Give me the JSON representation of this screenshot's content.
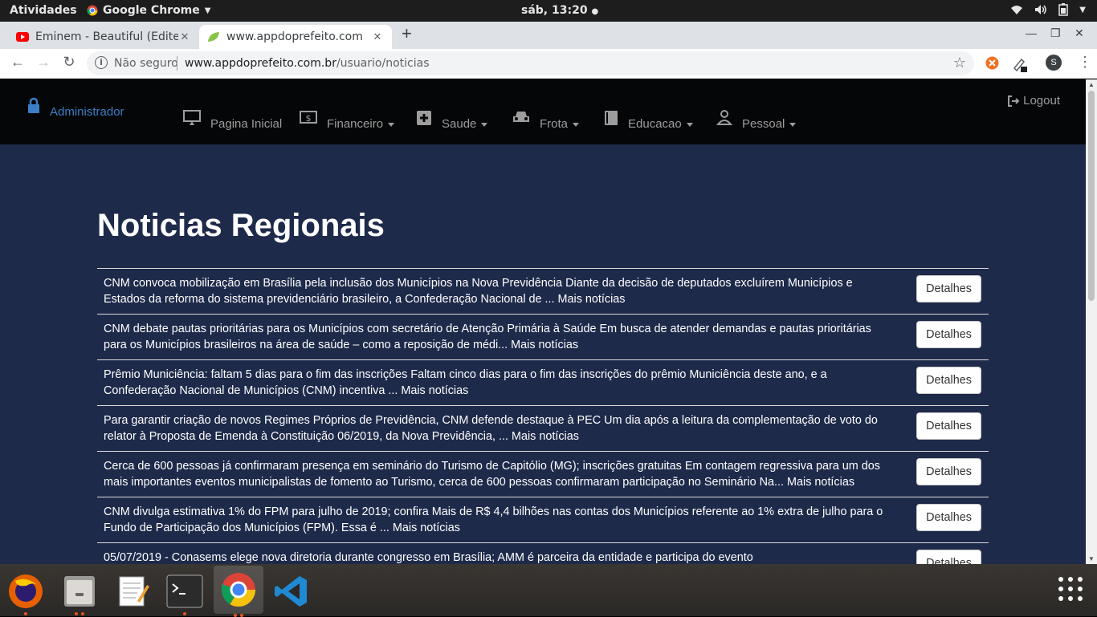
{
  "topbar": {
    "activities": "Atividades",
    "app_name": "Google Chrome",
    "clock": "sáb, 13:20"
  },
  "tabs": [
    {
      "title": "Eminem - Beautiful (Edite",
      "icon": "youtube-icon",
      "active": false
    },
    {
      "title": "www.appdoprefeito.com",
      "icon": "leaf-icon",
      "active": true
    }
  ],
  "omnibox": {
    "security": "Não seguro",
    "host": "www.appdoprefeito.com.br",
    "path": "/usuario/noticias"
  },
  "profile_initial": "S",
  "navbar": {
    "user": "Administrador",
    "logout": "Logout",
    "menu": [
      {
        "label": "Pagina Inicial",
        "icon": "monitor-icon",
        "dropdown": false
      },
      {
        "label": "Financeiro",
        "icon": "money-icon",
        "dropdown": true
      },
      {
        "label": "Saude",
        "icon": "plus-square-icon",
        "dropdown": true
      },
      {
        "label": "Frota",
        "icon": "car-icon",
        "dropdown": true
      },
      {
        "label": "Educacao",
        "icon": "book-icon",
        "dropdown": true
      },
      {
        "label": "Pessoal",
        "icon": "user-icon",
        "dropdown": true
      }
    ]
  },
  "page": {
    "heading": "Noticias Regionais",
    "details_label": "Detalhes",
    "news": [
      "CNM convoca mobilização em Brasília pela inclusão dos Municípios na Nova Previdência Diante da decisão de deputados excluírem Municípios e Estados da reforma do sistema previdenciário brasileiro, a Confederação Nacional de ... Mais notícias",
      "CNM debate pautas prioritárias para os Municípios com secretário de Atenção Primária à Saúde Em busca de atender demandas e pautas prioritárias para os Municípios brasileiros na área de saúde – como a reposição de médi... Mais notícias",
      "Prêmio Municiência: faltam 5 dias para o fim das inscrições Faltam cinco dias para o fim das inscrições do prêmio Municiência deste ano, e a Confederação Nacional de Municípios (CNM) incentiva ... Mais notícias",
      "Para garantir criação de novos Regimes Próprios de Previdência, CNM defende destaque à PEC Um dia após a leitura da complementação de voto do relator à Proposta de Emenda à Constituição 06/2019, da Nova Previdência, ... Mais notícias",
      "Cerca de 600 pessoas já confirmaram presença em seminário do Turismo de Capitólio (MG); inscrições gratuitas Em contagem regressiva para um dos mais importantes eventos municipalistas de fomento ao Turismo, cerca de 600 pessoas confirmaram participação no Seminário Na... Mais notícias",
      "CNM divulga estimativa 1% do FPM para julho de 2019; confira Mais de R$ 4,4 bilhões nas contas dos Municípios referente ao 1% extra de julho para o Fundo de Participação dos Municípios (FPM). Essa é ... Mais notícias",
      "05/07/2019 - Conasems elege nova diretoria durante congresso em Brasília; AMM é parceira da entidade e participa do evento"
    ]
  },
  "dock": [
    {
      "name": "firefox-icon"
    },
    {
      "name": "files-icon"
    },
    {
      "name": "text-editor-icon"
    },
    {
      "name": "terminal-icon"
    },
    {
      "name": "chrome-icon"
    },
    {
      "name": "vscode-icon"
    }
  ]
}
